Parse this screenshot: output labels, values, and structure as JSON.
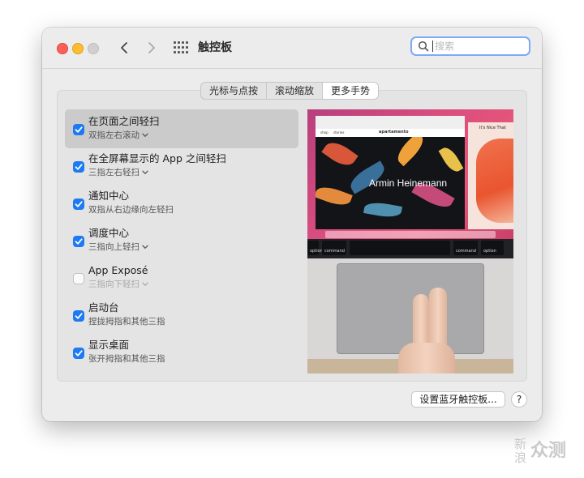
{
  "window": {
    "title": "触控板",
    "search": {
      "placeholder": "搜索",
      "value": ""
    }
  },
  "tabs": [
    {
      "label": "光标与点按",
      "active": false
    },
    {
      "label": "滚动缩放",
      "active": false
    },
    {
      "label": "更多手势",
      "active": true
    }
  ],
  "gestures": [
    {
      "name": "在页面之间轻扫",
      "detail": "双指左右滚动",
      "checked": true,
      "has_menu": true,
      "selected": true
    },
    {
      "name": "在全屏幕显示的 App 之间轻扫",
      "detail": "三指左右轻扫",
      "checked": true,
      "has_menu": true
    },
    {
      "name": "通知中心",
      "detail": "双指从右边缘向左轻扫",
      "checked": true,
      "has_menu": false
    },
    {
      "name": "调度中心",
      "detail": "三指向上轻扫",
      "checked": true,
      "has_menu": true
    },
    {
      "name": "App Exposé",
      "detail": "三指向下轻扫",
      "checked": false,
      "has_menu": true,
      "disabled": true
    },
    {
      "name": "启动台",
      "detail": "捏拢拇指和其他三指",
      "checked": true,
      "has_menu": false
    },
    {
      "name": "显示桌面",
      "detail": "张开拇指和其他三指",
      "checked": true,
      "has_menu": false
    }
  ],
  "preview": {
    "site_name": "apartamento",
    "nav_left": [
      "shop",
      "stories"
    ],
    "side_text": "It's Nice That",
    "hero_text": "Armin Heinemann",
    "keys": [
      "option",
      "command",
      "command",
      "option"
    ]
  },
  "footer": {
    "bluetooth_button": "设置蓝牙触控板...",
    "help_button": "?"
  },
  "watermark": {
    "part1": "新浪",
    "part2": "众测"
  },
  "colors": {
    "accent": "#1d7af3",
    "search_focus": "#7eaaf3"
  }
}
